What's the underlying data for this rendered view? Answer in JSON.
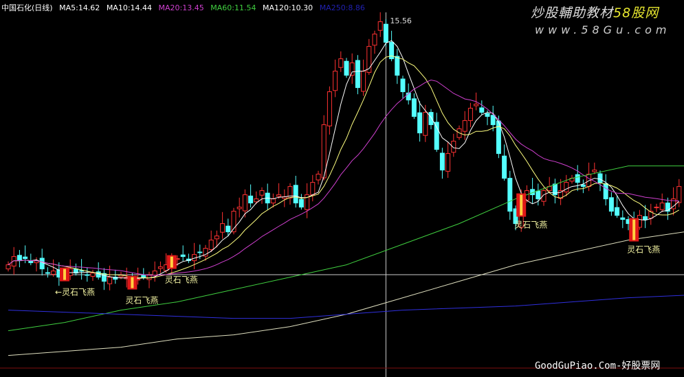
{
  "header": {
    "title": "中国石化(日线)",
    "ma5": "MA5:14.62",
    "ma10": "MA10:14.44",
    "ma20": "MA20:13.45",
    "ma60": "MA60:11.54",
    "ma120": "MA120:10.30",
    "ma250": "MA250:8.86"
  },
  "watermark": {
    "line1a": "炒股輔助教材",
    "line1b": "58股网",
    "line2": "www.58Gu.com",
    "bottom": "GoodGuPiao.Com-好股票网"
  },
  "colors": {
    "up": "#ff3232",
    "down": "#54ffff",
    "ma5": "#ffffff",
    "ma10": "#ffff80",
    "ma20": "#d040d0",
    "ma60": "#40d040",
    "ma120": "#e0e0c0",
    "ma250": "#3030e0"
  },
  "chart_data": {
    "type": "candlestick",
    "title": "中国石化(日线)",
    "ylim": [
      6.7,
      15.9
    ],
    "closes": [
      9.6,
      9.8,
      9.7,
      9.75,
      9.65,
      9.7,
      9.5,
      9.4,
      9.45,
      9.3,
      9.4,
      9.5,
      9.4,
      9.45,
      9.35,
      9.4,
      9.3,
      9.2,
      9.3,
      9.25,
      9.35,
      9.3,
      9.2,
      9.25,
      9.3,
      9.35,
      9.45,
      9.55,
      9.6,
      9.7,
      9.75,
      9.8,
      9.7,
      9.85,
      9.9,
      10.0,
      10.2,
      10.3,
      10.6,
      10.4,
      10.9,
      11.0,
      11.3,
      11.1,
      11.2,
      11.4,
      11.1,
      11.2,
      11.3,
      11.25,
      11.5,
      11.1,
      11.0,
      11.3,
      11.6,
      11.8,
      13.0,
      13.8,
      14.3,
      14.6,
      14.2,
      14.5,
      13.9,
      14.3,
      14.9,
      15.2,
      15.5,
      15.0,
      14.6,
      14.2,
      13.8,
      13.6,
      13.2,
      12.8,
      13.3,
      13.0,
      12.4,
      11.9,
      12.3,
      12.6,
      12.9,
      13.1,
      13.4,
      13.5,
      13.3,
      13.2,
      13.0,
      12.3,
      11.7,
      10.9,
      10.6,
      11.2,
      11.4,
      11.3,
      11.2,
      11.4,
      11.5,
      11.3,
      11.4,
      11.6,
      11.7,
      11.6,
      11.5,
      11.8,
      11.9,
      11.6,
      11.2,
      10.9,
      10.8,
      10.7,
      10.6,
      10.6,
      10.8,
      10.7,
      10.9,
      11.0,
      11.1,
      10.9,
      11.2,
      11.5
    ],
    "ma60_sampled": [
      8.0,
      8.2,
      8.5,
      8.7,
      9.0,
      9.3,
      9.6,
      10.1,
      10.6,
      11.2,
      11.7,
      12.0,
      12.0
    ],
    "ma120_sampled": [
      7.4,
      7.5,
      7.6,
      7.8,
      7.9,
      8.1,
      8.4,
      8.8,
      9.2,
      9.6,
      9.9,
      10.2,
      10.4
    ],
    "ma250_sampled": [
      8.5,
      8.45,
      8.4,
      8.35,
      8.3,
      8.3,
      8.4,
      8.5,
      8.55,
      8.6,
      8.7,
      8.8,
      8.86
    ],
    "high_label": "15.56",
    "high_index": 67,
    "cursor_index": 67,
    "cursor_price": 9.36,
    "signals": [
      {
        "index": 10,
        "label": "←灵石飞燕"
      },
      {
        "index": 22,
        "label": "灵石飞燕"
      },
      {
        "index": 29,
        "label": "灵石飞燕"
      },
      {
        "index": 91,
        "label": "灵石飞燕"
      },
      {
        "index": 111,
        "label": "灵石飞燕"
      }
    ]
  }
}
